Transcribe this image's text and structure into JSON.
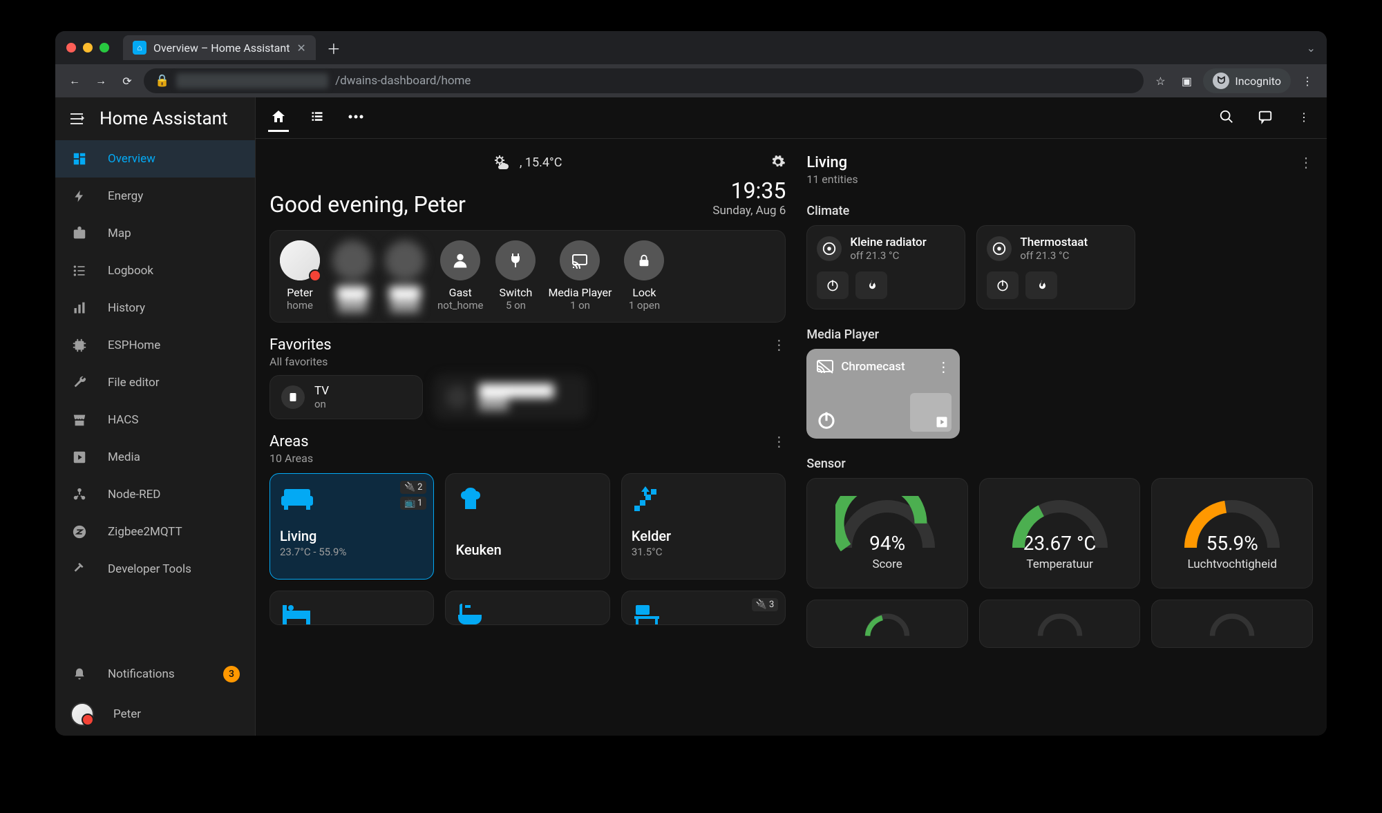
{
  "browser": {
    "tab_title": "Overview – Home Assistant",
    "url_suffix": "/dwains-dashboard/home",
    "incognito_label": "Incognito"
  },
  "sidebar": {
    "title": "Home Assistant",
    "items": [
      {
        "label": "Overview"
      },
      {
        "label": "Energy"
      },
      {
        "label": "Map"
      },
      {
        "label": "Logbook"
      },
      {
        "label": "History"
      },
      {
        "label": "ESPHome"
      },
      {
        "label": "File editor"
      },
      {
        "label": "HACS"
      },
      {
        "label": "Media"
      },
      {
        "label": "Node-RED"
      },
      {
        "label": "Zigbee2MQTT"
      },
      {
        "label": "Developer Tools"
      }
    ],
    "notifications_label": "Notifications",
    "notifications_count": "3",
    "user": "Peter"
  },
  "dashboard": {
    "weather_temp": ", 15.4°C",
    "greeting": "Good evening, Peter",
    "time": "19:35",
    "date": "Sunday, Aug 6",
    "people": [
      {
        "name": "Peter",
        "state": "home"
      },
      {
        "name": "",
        "state": ""
      },
      {
        "name": "",
        "state": ""
      },
      {
        "name": "Gast",
        "state": "not_home"
      },
      {
        "name": "Switch",
        "state": "5 on"
      },
      {
        "name": "Media Player",
        "state": "1 on"
      },
      {
        "name": "Lock",
        "state": "1 open"
      }
    ],
    "favorites": {
      "title": "Favorites",
      "subtitle": "All favorites",
      "items": [
        {
          "name": "TV",
          "state": "on"
        }
      ]
    },
    "areas": {
      "title": "Areas",
      "subtitle": "10 Areas",
      "items": [
        {
          "name": "Living",
          "info": "23.7°C - 55.9%",
          "badges": [
            "2",
            "1"
          ]
        },
        {
          "name": "Keuken",
          "info": ""
        },
        {
          "name": "Kelder",
          "info": "31.5°C"
        },
        {
          "name": "",
          "info": ""
        },
        {
          "name": "",
          "info": ""
        },
        {
          "name": "",
          "info": "",
          "badges": [
            "3"
          ]
        }
      ]
    }
  },
  "right": {
    "title": "Living",
    "subtitle": "11 entities",
    "climate": {
      "title": "Climate",
      "items": [
        {
          "name": "Kleine radiator",
          "state": "off 21.3 °C"
        },
        {
          "name": "Thermostaat",
          "state": "off 21.3 °C"
        }
      ]
    },
    "media": {
      "title": "Media Player",
      "name": "Chromecast"
    },
    "sensor": {
      "title": "Sensor",
      "items": [
        {
          "value": "94%",
          "label": "Score",
          "color": "#4caf50",
          "pct": 0.8
        },
        {
          "value": "23.67 °C",
          "label": "Temperatuur",
          "color": "#4caf50",
          "pct": 0.35
        },
        {
          "value": "55.9%",
          "label": "Luchtvochtigheid",
          "color": "#ff9800",
          "pct": 0.45
        }
      ]
    }
  }
}
